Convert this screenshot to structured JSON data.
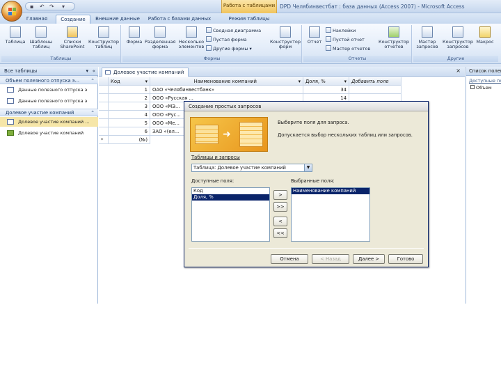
{
  "window": {
    "title": "DPD Челябинвестбат : база данных (Access 2007) - Microsoft Access",
    "context_tab": "Работа с таблицами"
  },
  "ribbon_tabs": [
    {
      "label": "Главная",
      "active": false
    },
    {
      "label": "Создание",
      "active": true
    },
    {
      "label": "Внешние данные",
      "active": false
    },
    {
      "label": "Работа с базами данных",
      "active": false
    },
    {
      "label": "Режим таблицы",
      "active": false
    }
  ],
  "ribbon": {
    "tables": {
      "name": "Таблицы",
      "buttons": [
        "Таблица",
        "Шаблоны таблиц",
        "Списки SharePoint",
        "Конструктор таблиц"
      ]
    },
    "forms": {
      "name": "Формы",
      "big": [
        "Форма",
        "Разделенная форма",
        "Несколько элементов"
      ],
      "small": [
        "Сводная диаграмма",
        "Пустая форма",
        "Другие формы"
      ],
      "designer": "Конструктор форм"
    },
    "reports": {
      "name": "Отчеты",
      "big": [
        "Отчет"
      ],
      "small": [
        "Наклейки",
        "Пустой отчет",
        "Мастер отчетов"
      ],
      "designer": "Конструктор отчетов"
    },
    "other": {
      "name": "Другие",
      "buttons": [
        "Мастер запросов",
        "Конструктор запросов",
        "Макрос"
      ]
    }
  },
  "nav": {
    "header": "Все таблицы",
    "groups": [
      {
        "title": "Объем полезного отпуска э...",
        "items": [
          {
            "label": "Данные полезного отпуска э",
            "kind": "table"
          },
          {
            "label": "Данные полезного отпуска э",
            "kind": "table"
          }
        ]
      },
      {
        "title": "Долевое участие компаний",
        "items": [
          {
            "label": "Долевое участие компаний ...",
            "kind": "table"
          },
          {
            "label": "Долевое участие компаний",
            "kind": "query"
          }
        ]
      }
    ]
  },
  "document": {
    "tab": "Долевое участие компаний",
    "columns": [
      "Код",
      "Наименование компаний",
      "Доля, %",
      "Добавить поле"
    ],
    "rows": [
      {
        "id": "1",
        "name": "ОАО «Челябинвестбанк»",
        "share": "34"
      },
      {
        "id": "2",
        "name": "ООО «Русская ...",
        "share": "14"
      },
      {
        "id": "3",
        "name": "ООО «МЭ...",
        "share": ""
      },
      {
        "id": "4",
        "name": "ООО «Рус...",
        "share": ""
      },
      {
        "id": "5",
        "name": "ООО «Ме...",
        "share": ""
      },
      {
        "id": "6",
        "name": "ЗАО «(ел...",
        "share": ""
      }
    ],
    "new_row_marker": "*",
    "new_row_label": "(№)"
  },
  "right_pane": {
    "title": "Список полей",
    "sub": "Доступные поля",
    "item": "Объем"
  },
  "dialog": {
    "title": "Создание простых запросов",
    "heading": "Выберите поля для запроса.",
    "hint": "Допускается выбор нескольких таблиц или запросов.",
    "tables_label": "Таблицы и запросы",
    "tables_value": "Таблица: Долевое участие компаний",
    "available_label": "Доступные поля:",
    "selected_label": "Выбранные поля:",
    "available": [
      {
        "label": "Код",
        "selected": false
      },
      {
        "label": "Доля, %",
        "selected": true
      }
    ],
    "selected": [
      {
        "label": "Наименование компаний",
        "selected": true
      }
    ],
    "move_buttons": [
      ">",
      ">>",
      "<",
      "<<"
    ],
    "footer_buttons": [
      {
        "label": "Отмена",
        "disabled": false
      },
      {
        "label": "< Назад",
        "disabled": true
      },
      {
        "label": "Далее >",
        "disabled": false
      },
      {
        "label": "Готово",
        "disabled": false
      }
    ]
  },
  "colors": {
    "accent": "#0a246a",
    "ribbon": "#d4e2f4",
    "context": "#f0c45d"
  }
}
